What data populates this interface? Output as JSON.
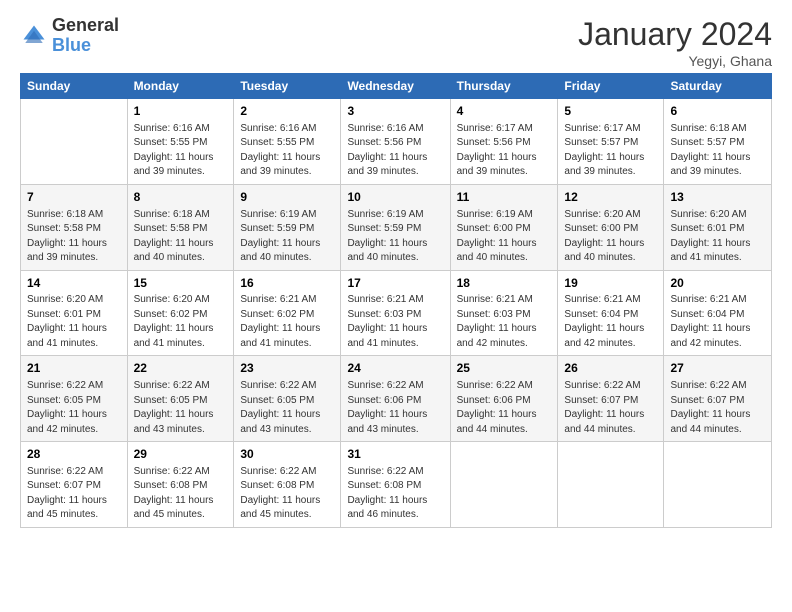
{
  "logo": {
    "text_general": "General",
    "text_blue": "Blue"
  },
  "title": "January 2024",
  "location": "Yegyi, Ghana",
  "days_of_week": [
    "Sunday",
    "Monday",
    "Tuesday",
    "Wednesday",
    "Thursday",
    "Friday",
    "Saturday"
  ],
  "weeks": [
    [
      {
        "day": "",
        "info": ""
      },
      {
        "day": "1",
        "info": "Sunrise: 6:16 AM\nSunset: 5:55 PM\nDaylight: 11 hours and 39 minutes."
      },
      {
        "day": "2",
        "info": "Sunrise: 6:16 AM\nSunset: 5:55 PM\nDaylight: 11 hours and 39 minutes."
      },
      {
        "day": "3",
        "info": "Sunrise: 6:16 AM\nSunset: 5:56 PM\nDaylight: 11 hours and 39 minutes."
      },
      {
        "day": "4",
        "info": "Sunrise: 6:17 AM\nSunset: 5:56 PM\nDaylight: 11 hours and 39 minutes."
      },
      {
        "day": "5",
        "info": "Sunrise: 6:17 AM\nSunset: 5:57 PM\nDaylight: 11 hours and 39 minutes."
      },
      {
        "day": "6",
        "info": "Sunrise: 6:18 AM\nSunset: 5:57 PM\nDaylight: 11 hours and 39 minutes."
      }
    ],
    [
      {
        "day": "7",
        "info": "Sunrise: 6:18 AM\nSunset: 5:58 PM\nDaylight: 11 hours and 39 minutes."
      },
      {
        "day": "8",
        "info": "Sunrise: 6:18 AM\nSunset: 5:58 PM\nDaylight: 11 hours and 40 minutes."
      },
      {
        "day": "9",
        "info": "Sunrise: 6:19 AM\nSunset: 5:59 PM\nDaylight: 11 hours and 40 minutes."
      },
      {
        "day": "10",
        "info": "Sunrise: 6:19 AM\nSunset: 5:59 PM\nDaylight: 11 hours and 40 minutes."
      },
      {
        "day": "11",
        "info": "Sunrise: 6:19 AM\nSunset: 6:00 PM\nDaylight: 11 hours and 40 minutes."
      },
      {
        "day": "12",
        "info": "Sunrise: 6:20 AM\nSunset: 6:00 PM\nDaylight: 11 hours and 40 minutes."
      },
      {
        "day": "13",
        "info": "Sunrise: 6:20 AM\nSunset: 6:01 PM\nDaylight: 11 hours and 41 minutes."
      }
    ],
    [
      {
        "day": "14",
        "info": "Sunrise: 6:20 AM\nSunset: 6:01 PM\nDaylight: 11 hours and 41 minutes."
      },
      {
        "day": "15",
        "info": "Sunrise: 6:20 AM\nSunset: 6:02 PM\nDaylight: 11 hours and 41 minutes."
      },
      {
        "day": "16",
        "info": "Sunrise: 6:21 AM\nSunset: 6:02 PM\nDaylight: 11 hours and 41 minutes."
      },
      {
        "day": "17",
        "info": "Sunrise: 6:21 AM\nSunset: 6:03 PM\nDaylight: 11 hours and 41 minutes."
      },
      {
        "day": "18",
        "info": "Sunrise: 6:21 AM\nSunset: 6:03 PM\nDaylight: 11 hours and 42 minutes."
      },
      {
        "day": "19",
        "info": "Sunrise: 6:21 AM\nSunset: 6:04 PM\nDaylight: 11 hours and 42 minutes."
      },
      {
        "day": "20",
        "info": "Sunrise: 6:21 AM\nSunset: 6:04 PM\nDaylight: 11 hours and 42 minutes."
      }
    ],
    [
      {
        "day": "21",
        "info": "Sunrise: 6:22 AM\nSunset: 6:05 PM\nDaylight: 11 hours and 42 minutes."
      },
      {
        "day": "22",
        "info": "Sunrise: 6:22 AM\nSunset: 6:05 PM\nDaylight: 11 hours and 43 minutes."
      },
      {
        "day": "23",
        "info": "Sunrise: 6:22 AM\nSunset: 6:05 PM\nDaylight: 11 hours and 43 minutes."
      },
      {
        "day": "24",
        "info": "Sunrise: 6:22 AM\nSunset: 6:06 PM\nDaylight: 11 hours and 43 minutes."
      },
      {
        "day": "25",
        "info": "Sunrise: 6:22 AM\nSunset: 6:06 PM\nDaylight: 11 hours and 44 minutes."
      },
      {
        "day": "26",
        "info": "Sunrise: 6:22 AM\nSunset: 6:07 PM\nDaylight: 11 hours and 44 minutes."
      },
      {
        "day": "27",
        "info": "Sunrise: 6:22 AM\nSunset: 6:07 PM\nDaylight: 11 hours and 44 minutes."
      }
    ],
    [
      {
        "day": "28",
        "info": "Sunrise: 6:22 AM\nSunset: 6:07 PM\nDaylight: 11 hours and 45 minutes."
      },
      {
        "day": "29",
        "info": "Sunrise: 6:22 AM\nSunset: 6:08 PM\nDaylight: 11 hours and 45 minutes."
      },
      {
        "day": "30",
        "info": "Sunrise: 6:22 AM\nSunset: 6:08 PM\nDaylight: 11 hours and 45 minutes."
      },
      {
        "day": "31",
        "info": "Sunrise: 6:22 AM\nSunset: 6:08 PM\nDaylight: 11 hours and 46 minutes."
      },
      {
        "day": "",
        "info": ""
      },
      {
        "day": "",
        "info": ""
      },
      {
        "day": "",
        "info": ""
      }
    ]
  ]
}
